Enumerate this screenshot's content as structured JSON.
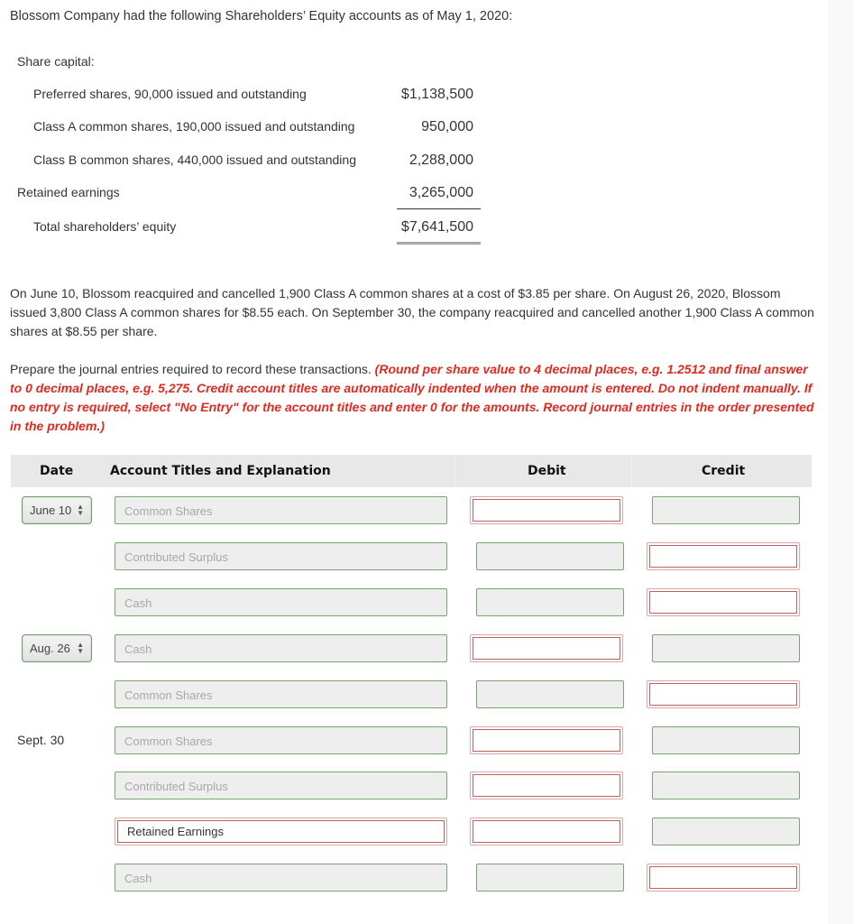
{
  "intro": "Blossom Company had the following Shareholders’ Equity accounts as of May 1, 2020:",
  "equity": {
    "section_label": "Share capital:",
    "lines": [
      {
        "label": "Preferred shares, 90,000 issued and outstanding",
        "amount": "$1,138,500"
      },
      {
        "label": "Class A common shares, 190,000 issued and outstanding",
        "amount": "950,000"
      },
      {
        "label": "Class B common shares, 440,000 issued and outstanding",
        "amount": "2,288,000"
      },
      {
        "label": "Retained earnings",
        "amount": "3,265,000"
      },
      {
        "label": "Total shareholders’ equity",
        "amount": "$7,641,500"
      }
    ]
  },
  "scenario": "On June 10, Blossom reacquired and cancelled 1,900 Class A common shares at a cost of $3.85 per share. On August 26, 2020, Blossom issued 3,800 Class A common shares for $8.55 each. On September 30, the company reacquired and cancelled another 1,900 Class A common shares at $8.55 per share.",
  "instructions": {
    "lead": "Prepare the journal entries required to record these transactions. ",
    "note": "(Round per share value to 4 decimal places, e.g. 1.2512 and final answer to 0 decimal places, e.g. 5,275. Credit account titles are automatically indented when the amount is entered. Do not indent manually. If no entry is required, select \"No Entry\" for the account titles and enter 0 for the amounts. Record journal entries in the order presented in the problem.)"
  },
  "journal": {
    "headers": {
      "date": "Date",
      "account": "Account Titles and Explanation",
      "debit": "Debit",
      "credit": "Credit"
    },
    "rows": [
      {
        "date": "June 10",
        "date_type": "select",
        "account": "Common Shares",
        "account_state": "filled",
        "debit": "",
        "debit_state": "error",
        "credit": "",
        "credit_state": "filled"
      },
      {
        "date": "",
        "date_type": "none",
        "account": "Contributed Surplus",
        "account_state": "filled",
        "debit": "",
        "debit_state": "filled",
        "credit": "",
        "credit_state": "error"
      },
      {
        "date": "",
        "date_type": "none",
        "account": "Cash",
        "account_state": "filled",
        "debit": "",
        "debit_state": "filled",
        "credit": "",
        "credit_state": "error"
      },
      {
        "date": "Aug. 26",
        "date_type": "select",
        "account": "Cash",
        "account_state": "filled",
        "debit": "",
        "debit_state": "error",
        "credit": "",
        "credit_state": "filled"
      },
      {
        "date": "",
        "date_type": "none",
        "account": "Common Shares",
        "account_state": "filled",
        "debit": "",
        "debit_state": "filled",
        "credit": "",
        "credit_state": "error"
      },
      {
        "date": "Sept. 30",
        "date_type": "text",
        "account": "Common Shares",
        "account_state": "filled",
        "debit": "",
        "debit_state": "error",
        "credit": "",
        "credit_state": "filled"
      },
      {
        "date": "",
        "date_type": "none",
        "account": "Contributed Surplus",
        "account_state": "filled",
        "debit": "",
        "debit_state": "error",
        "credit": "",
        "credit_state": "filled"
      },
      {
        "date": "",
        "date_type": "none",
        "account": "Retained Earnings",
        "account_state": "error",
        "debit": "",
        "debit_state": "error",
        "credit": "",
        "credit_state": "filled"
      },
      {
        "date": "",
        "date_type": "none",
        "account": "Cash",
        "account_state": "filled",
        "debit": "",
        "debit_state": "filled",
        "credit": "",
        "credit_state": "error"
      }
    ]
  },
  "colors": {
    "instruction_red": "#e02a20",
    "valid_border": "#7aa274",
    "error_border": "#b86464",
    "header_bg": "#e8e8e8"
  }
}
